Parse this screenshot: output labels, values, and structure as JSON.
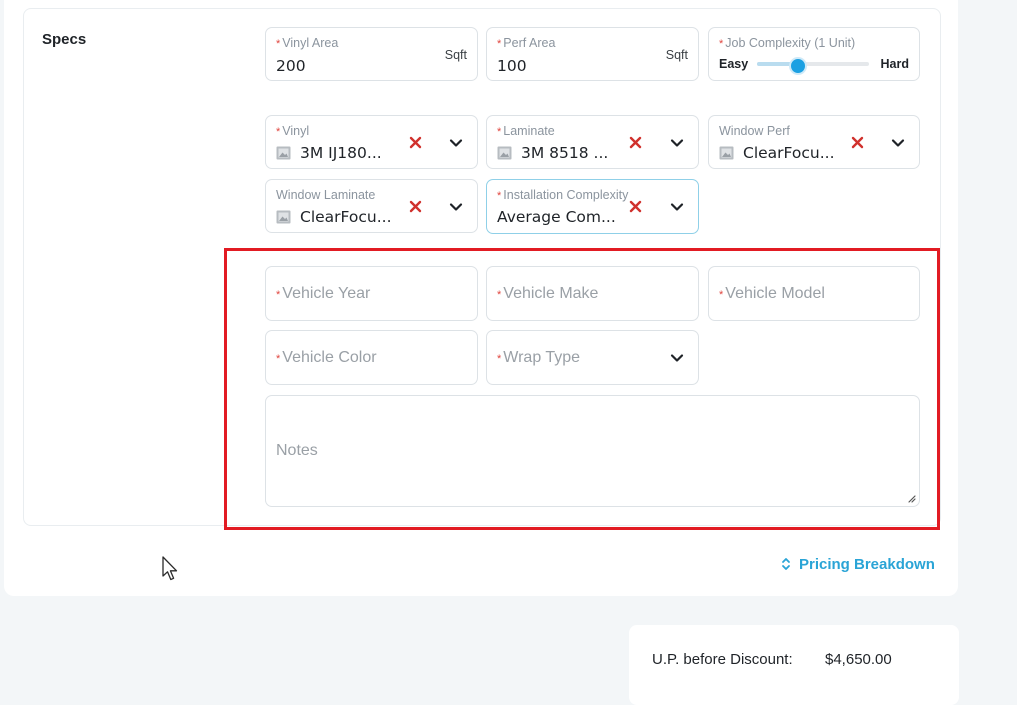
{
  "specs": {
    "title": "Specs",
    "vinyl_area": {
      "label": "Vinyl Area",
      "value": "200",
      "unit": "Sqft"
    },
    "perf_area": {
      "label": "Perf Area",
      "value": "100",
      "unit": "Sqft"
    },
    "job_complexity": {
      "label": "Job Complexity (1 Unit)",
      "min_label": "Easy",
      "max_label": "Hard",
      "level_fraction": 0.35
    },
    "vinyl": {
      "label": "Vinyl",
      "value": "3M IJ180..."
    },
    "laminate": {
      "label": "Laminate",
      "value": "3M 8518 ..."
    },
    "window_perf": {
      "label": "Window Perf",
      "value": "ClearFocu..."
    },
    "window_laminate": {
      "label": "Window Laminate",
      "value": "ClearFocu..."
    },
    "installation_complexity": {
      "label": "Installation Complexity",
      "value": "Average Com..."
    }
  },
  "vehicle": {
    "year_placeholder": "Vehicle Year",
    "make_placeholder": "Vehicle Make",
    "model_placeholder": "Vehicle Model",
    "color_placeholder": "Vehicle Color",
    "wrap_type_placeholder": "Wrap Type",
    "notes_placeholder": "Notes"
  },
  "required_mark": "*",
  "pricing_breakdown_label": "Pricing Breakdown",
  "summary": {
    "up_before_discount_label": "U.P. before Discount:",
    "up_before_discount_value": "$4,650.00"
  },
  "colors": {
    "accent": "#2aa4d6",
    "required": "#e0443e",
    "highlight": "#e21b23",
    "slider": "#1ba0e2"
  },
  "icons": {
    "image": "image-placeholder-icon",
    "clear": "clear-x-icon",
    "dropdown": "chevron-down-icon",
    "sort": "sort-arrows-icon",
    "cursor": "mouse-pointer-icon"
  }
}
